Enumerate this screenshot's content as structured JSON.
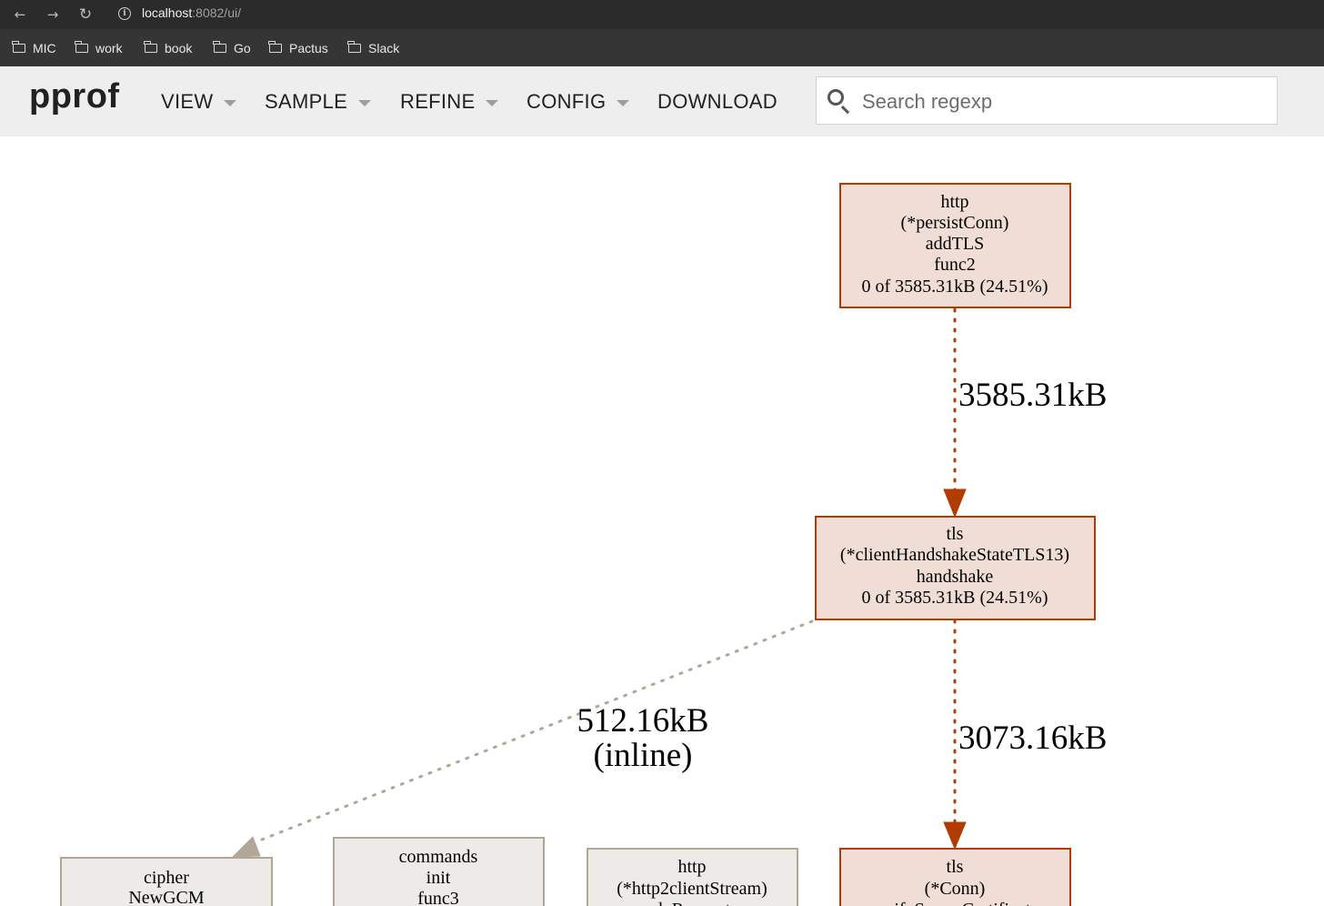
{
  "browser": {
    "back_icon": "arrow-left-icon",
    "forward_icon": "arrow-right-icon",
    "reload_icon": "reload-icon",
    "url_host": "localhost",
    "url_rest": ":8082/ui/"
  },
  "bookmarks": [
    {
      "label": "MIC",
      "icon": "folder-icon"
    },
    {
      "label": "work",
      "icon": "folder-icon"
    },
    {
      "label": "book",
      "icon": "folder-icon"
    },
    {
      "label": "Go",
      "icon": "folder-icon"
    },
    {
      "label": "Pactus",
      "icon": "folder-icon"
    },
    {
      "label": "Slack",
      "icon": "folder-icon"
    }
  ],
  "app": {
    "logo": "pprof",
    "menu": [
      {
        "label": "VIEW",
        "dropdown": true
      },
      {
        "label": "SAMPLE",
        "dropdown": true
      },
      {
        "label": "REFINE",
        "dropdown": true
      },
      {
        "label": "CONFIG",
        "dropdown": true
      },
      {
        "label": "DOWNLOAD",
        "dropdown": false
      }
    ],
    "search_placeholder": "Search regexp"
  },
  "graph": {
    "colors": {
      "hot_fill": "#f0ddd5",
      "hot_stroke": "#b23c00",
      "cold_fill": "#edebe7",
      "cold_stroke": "#b2a797"
    },
    "nodes": [
      {
        "id": "persist-conn-addtls",
        "lines": [
          "http",
          "(*persistConn)",
          "addTLS",
          "func2",
          "0 of 3585.31kB (24.51%)"
        ]
      },
      {
        "id": "client-handshake-tls13",
        "lines": [
          "tls",
          "(*clientHandshakeStateTLS13)",
          "handshake",
          "0 of 3585.31kB (24.51%)"
        ]
      },
      {
        "id": "cipher-newgcm",
        "lines": [
          "cipher",
          "NewGCM"
        ]
      },
      {
        "id": "commands-init-func3",
        "lines": [
          "commands",
          "init",
          "func3"
        ]
      },
      {
        "id": "http2-client-stream",
        "lines": [
          "http",
          "(*http2clientStream)",
          "doRequest"
        ]
      },
      {
        "id": "tls-conn-verify",
        "lines": [
          "tls",
          "(*Conn)",
          "verifyServerCertificate"
        ]
      }
    ],
    "edges": [
      {
        "label": "3585.31kB"
      },
      {
        "label": "512.16kB",
        "label2": "(inline)"
      },
      {
        "label": "3073.16kB"
      }
    ]
  }
}
